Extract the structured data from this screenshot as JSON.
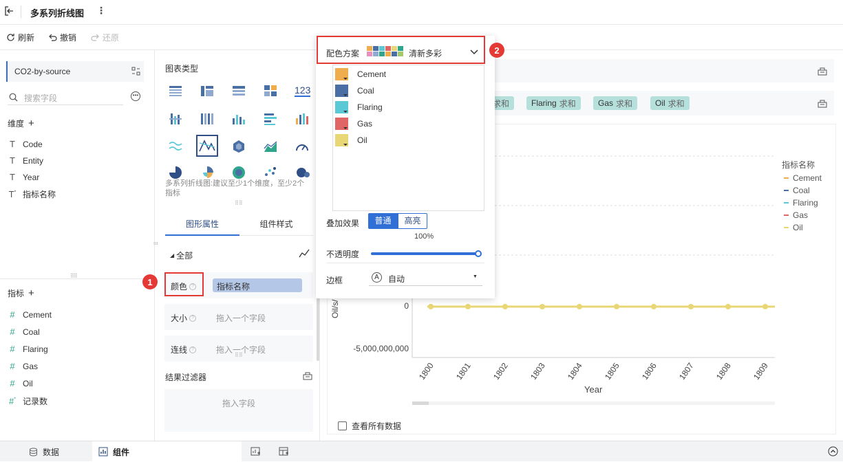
{
  "topbar": {
    "title": "多系列折线图"
  },
  "toolbar": {
    "refresh": "刷新",
    "undo": "撤销",
    "redo": "还原"
  },
  "left": {
    "dataset": "CO2-by-source",
    "search_placeholder": "搜索字段",
    "dimensions_title": "维度",
    "dimensions": [
      "Code",
      "Entity",
      "Year",
      "指标名称"
    ],
    "measures_title": "指标",
    "measures": [
      "Cement",
      "Coal",
      "Flaring",
      "Gas",
      "Oil",
      "记录数"
    ]
  },
  "mid": {
    "chart_type_title": "图表类型",
    "hint": "多系列折线图:建议至少1个维度，至少2个指标",
    "tabs": [
      "图形属性",
      "组件样式"
    ],
    "all_label": "全部",
    "color_label": "颜色",
    "color_value": "指标名称",
    "size_label": "大小",
    "line_label": "连线",
    "drop_placeholder": "拖入一个字段",
    "filter_title": "结果过滤器",
    "filter_placeholder": "拖入字段",
    "icon_123": "123"
  },
  "popup": {
    "scheme_label": "配色方案",
    "scheme_name": "清新多彩",
    "items": [
      {
        "name": "Cement",
        "color": "#f0ad4e"
      },
      {
        "name": "Coal",
        "color": "#4a6fa5"
      },
      {
        "name": "Flaring",
        "color": "#5bc8d6"
      },
      {
        "name": "Gas",
        "color": "#e06666"
      },
      {
        "name": "Oil",
        "color": "#e8d774"
      }
    ],
    "overlay_label": "叠加效果",
    "overlay_options": [
      "普通",
      "高亮"
    ],
    "opacity_value": "100%",
    "opacity_label": "不透明度",
    "border_label": "边框",
    "border_value": "自动",
    "auto_icon": "A"
  },
  "chips": [
    {
      "name": "Flaring",
      "agg": "求和"
    },
    {
      "name": "Gas",
      "agg": "求和"
    },
    {
      "name": "Oil",
      "agg": "求和"
    }
  ],
  "chip_partial_agg": "求和",
  "chart": {
    "legend_title": "指标名称",
    "legend": [
      "Cement",
      "Coal",
      "Flaring",
      "Gas",
      "Oil"
    ],
    "y_ticks": [
      "0",
      "-5,000,000,000"
    ],
    "y_label_partial": "Oil/s/…",
    "x_ticks": [
      "1800",
      "1801",
      "1802",
      "1803",
      "1804",
      "1805",
      "1806",
      "1807",
      "1808",
      "1809"
    ],
    "x_label": "Year",
    "view_all": "查看所有数据"
  },
  "chart_data": {
    "type": "line",
    "x": [
      "1800",
      "1801",
      "1802",
      "1803",
      "1804",
      "1805",
      "1806",
      "1807",
      "1808",
      "1809"
    ],
    "series": [
      {
        "name": "Oil",
        "values": [
          0,
          0,
          0,
          0,
          0,
          0,
          0,
          0,
          0,
          0
        ]
      }
    ],
    "xlabel": "Year"
  },
  "bottom": {
    "data_tab": "数据",
    "component_tab": "组件"
  },
  "annotations": {
    "one": "1",
    "two": "2"
  }
}
